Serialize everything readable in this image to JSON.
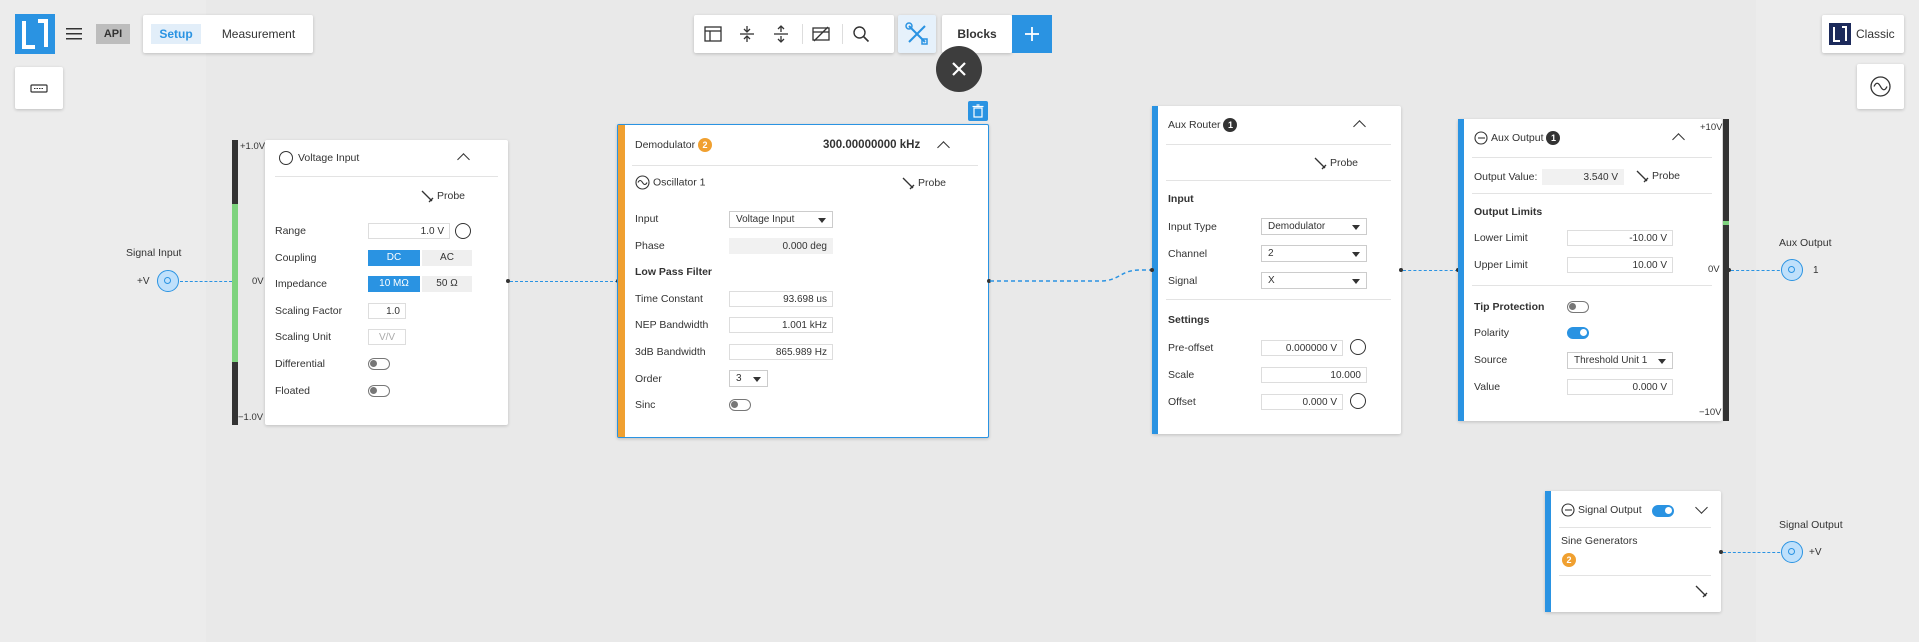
{
  "header": {
    "api_label": "API",
    "setup_label": "Setup",
    "measurement_label": "Measurement",
    "blocks_label": "Blocks",
    "classic_label": "Classic"
  },
  "signal_input": {
    "title": "Signal Input",
    "port_label": "+V"
  },
  "voltage_input": {
    "title": "Voltage Input",
    "probe": "Probe",
    "meter_top": "+1.0V",
    "meter_mid": "0V",
    "meter_bottom": "−1.0V",
    "meter_level": 1.0,
    "range_label": "Range",
    "range_value": "1.0 V",
    "coupling_label": "Coupling",
    "coupling_dc": "DC",
    "coupling_ac": "AC",
    "impedance_label": "Impedance",
    "impedance_10m": "10 MΩ",
    "impedance_50": "50 Ω",
    "scaling_factor_label": "Scaling Factor",
    "scaling_factor_value": "1.0",
    "scaling_unit_label": "Scaling Unit",
    "scaling_unit_value": "V/V",
    "differential_label": "Differential",
    "floated_label": "Floated"
  },
  "demodulator": {
    "title": "Demodulator",
    "badge": "2",
    "frequency": "300.00000000 kHz",
    "oscillator": "Oscillator 1",
    "probe": "Probe",
    "input_label": "Input",
    "input_value": "Voltage Input",
    "phase_label": "Phase",
    "phase_value": "0.000 deg",
    "lpf_title": "Low Pass Filter",
    "tc_label": "Time Constant",
    "tc_value": "93.698 us",
    "nep_label": "NEP Bandwidth",
    "nep_value": "1.001 kHz",
    "db3_label": "3dB Bandwidth",
    "db3_value": "865.989 Hz",
    "order_label": "Order",
    "order_value": "3",
    "sinc_label": "Sinc"
  },
  "aux_router": {
    "title": "Aux Router",
    "badge": "1",
    "probe": "Probe",
    "input_title": "Input",
    "input_type_label": "Input Type",
    "input_type_value": "Demodulator",
    "channel_label": "Channel",
    "channel_value": "2",
    "signal_label": "Signal",
    "signal_value": "X",
    "settings_title": "Settings",
    "preoffset_label": "Pre-offset",
    "preoffset_value": "0.000000 V",
    "scale_label": "Scale",
    "scale_value": "10.000",
    "offset_label": "Offset",
    "offset_value": "0.000 V"
  },
  "aux_output": {
    "title": "Aux Output",
    "badge": "1",
    "probe": "Probe",
    "output_value_label": "Output Value:",
    "output_value": "3.540 V",
    "limits_title": "Output Limits",
    "lower_label": "Lower Limit",
    "lower_value": "-10.00 V",
    "upper_label": "Upper Limit",
    "upper_value": "10.00 V",
    "tip_label": "Tip Protection",
    "polarity_label": "Polarity",
    "source_label": "Source",
    "source_value": "Threshold Unit 1",
    "value_label": "Value",
    "value_value": "0.000 V",
    "meter_top": "+10V",
    "meter_mid": "0V",
    "meter_bottom": "−10V",
    "port_title": "Aux Output",
    "port_label": "1"
  },
  "signal_output": {
    "title": "Signal Output",
    "sine_label": "Sine Generators",
    "sine_badge": "2",
    "port_title": "Signal Output",
    "port_label": "+V"
  },
  "colors": {
    "accent": "#2a93e2",
    "orange": "#f0a030",
    "meter_green": "#7ed37e"
  }
}
